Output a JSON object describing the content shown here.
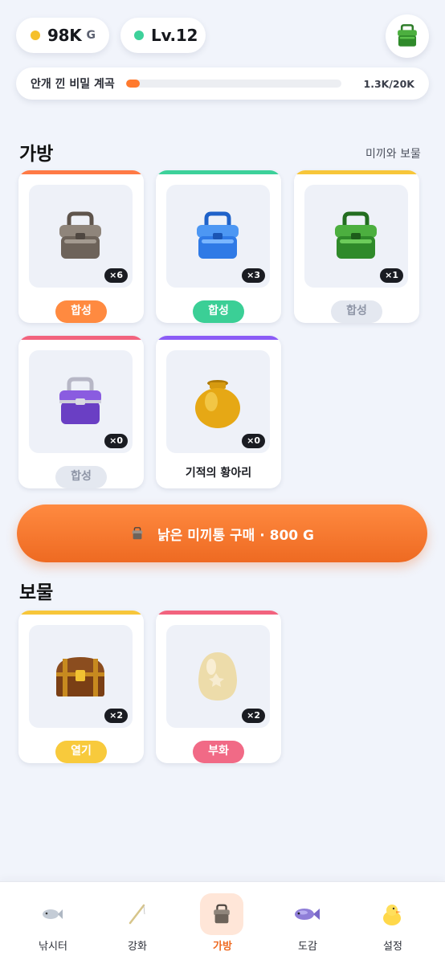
{
  "header": {
    "gold": {
      "value": "98K",
      "unit": "G",
      "dot_color": "#f5c02b"
    },
    "level": {
      "label": "Lv.12",
      "dot_color": "#3dd19a"
    },
    "avatar_icon": "green-cooler-icon"
  },
  "quest": {
    "label": "안개 낀 비밀 계곡",
    "count": "1.3K/20K",
    "progress": 0.065,
    "fill_color": "#ff7a2e"
  },
  "bag": {
    "title": "가방",
    "link": "미끼와 보물",
    "items": [
      {
        "icon": "gray-bait-box-icon",
        "qty": "×6",
        "action": "합성",
        "bar_color": "#ff7a45",
        "action_color": "#ff8a40",
        "action_text_color": "#ffffff"
      },
      {
        "icon": "blue-bait-box-icon",
        "qty": "×3",
        "action": "합성",
        "bar_color": "#3dd19a",
        "action_color": "#3bcf96",
        "action_text_color": "#ffffff"
      },
      {
        "icon": "green-bait-box-icon",
        "qty": "×1",
        "action": "합성",
        "bar_color": "#f7c63a",
        "action_color": "#e4e8f0",
        "action_text_color": "#8e95a6"
      },
      {
        "icon": "purple-bait-box-icon",
        "qty": "×0",
        "action": "합성",
        "bar_color": "#f2637e",
        "action_color": "#e4e8f0",
        "action_text_color": "#8e95a6"
      },
      {
        "icon": "golden-jar-icon",
        "qty": "×0",
        "name": "기적의 황아리",
        "bar_color": "#8b5cf6"
      }
    ],
    "buy_button": "낡은 미끼통 구매 · 800 G"
  },
  "treasure": {
    "title": "보물",
    "items": [
      {
        "icon": "treasure-chest-icon",
        "qty": "×2",
        "action": "열기",
        "bar_color": "#f7c63a",
        "action_color": "#f8ca3c",
        "action_text_color": "#ffffff"
      },
      {
        "icon": "egg-icon",
        "qty": "×2",
        "action": "부화",
        "bar_color": "#f2637e",
        "action_color": "#f16a86",
        "action_text_color": "#ffffff"
      }
    ]
  },
  "tabs": [
    {
      "label": "낚시터",
      "icon": "fish-icon"
    },
    {
      "label": "강화",
      "icon": "fishing-rod-icon"
    },
    {
      "label": "가방",
      "icon": "bait-box-icon",
      "active": true
    },
    {
      "label": "도감",
      "icon": "purple-fish-icon"
    },
    {
      "label": "설정",
      "icon": "duck-icon"
    }
  ]
}
